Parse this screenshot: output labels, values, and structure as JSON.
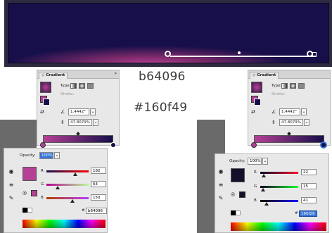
{
  "colors": {
    "magenta": "#b64096",
    "dark_navy": "#160f49",
    "banner_frame": "#2e2b40"
  },
  "overlay": {
    "hex_magenta": "b64096",
    "hex_navy": "#160f49"
  },
  "gradient_panel": {
    "tab_label": "Gradient",
    "type_label": "Type:",
    "stroke_label": "Stroke:",
    "aspect_value": "1.4442°",
    "scale_value": "47.8079%"
  },
  "color_panel_left": {
    "opacity_label": "Opacity:",
    "opacity_value": "100%",
    "r_label": "R",
    "g_label": "G",
    "b_label": "B",
    "r_value": "182",
    "g_value": "64",
    "b_value": "150",
    "hash": "#",
    "hex_value": "b64096"
  },
  "color_panel_right": {
    "opacity_label": "Opacity:",
    "opacity_value": "100%",
    "r_label": "R",
    "g_label": "G",
    "b_label": "B",
    "r_value": "22",
    "g_value": "15",
    "b_value": "41",
    "hash": "#",
    "hex_value": "160f29"
  },
  "icons": {
    "close": "»",
    "menu": "≡",
    "dropdown": "⌄",
    "eyedropper": "✎",
    "palette": "◉"
  }
}
